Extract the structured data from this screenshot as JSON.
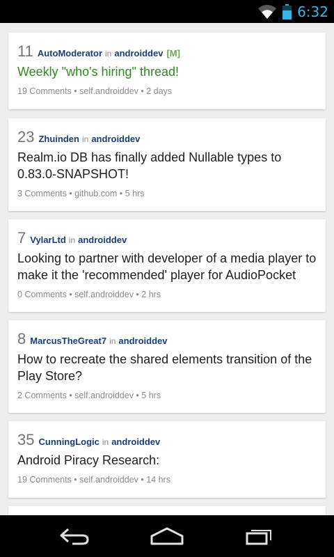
{
  "status_bar": {
    "time": "6:32",
    "wifi_icon": "wifi-icon",
    "battery_icon": "battery-icon"
  },
  "posts": [
    {
      "score": "11",
      "author": "AutoModerator",
      "in_word": "in",
      "subreddit": "androiddev",
      "mod_tag": "[M]",
      "title": "Weekly \"who's hiring\" thread!",
      "footer": "19 Comments • self.androiddev • 2 days"
    },
    {
      "score": "23",
      "author": "Zhuinden",
      "in_word": "in",
      "subreddit": "androiddev",
      "title": "Realm.io DB has finally added Nullable types to 0.83.0-SNAPSHOT!",
      "footer": "3 Comments • github.com • 5 hrs"
    },
    {
      "score": "7",
      "author": "VylarLtd",
      "in_word": "in",
      "subreddit": "androiddev",
      "title": "Looking to partner with developer of a media player to make it the 'recommended' player for AudioPocket",
      "footer": "0 Comments • self.androiddev • 2 hrs"
    },
    {
      "score": "8",
      "author": "MarcusTheGreat7",
      "in_word": "in",
      "subreddit": "androiddev",
      "title": "How to recreate the shared elements transition of the Play Store?",
      "footer": "2 Comments • self.androiddev • 5 hrs"
    },
    {
      "score": "35",
      "author": "CunningLogic",
      "in_word": "in",
      "subreddit": "androiddev",
      "title": "Android Piracy Research:",
      "footer": "19 Comments • self.androiddev • 14 hrs"
    }
  ],
  "nav_bar": {
    "back_icon": "back-icon",
    "home_icon": "home-icon",
    "recents_icon": "recents-icon"
  },
  "colors": {
    "background": "#eeeeee",
    "author": "#1a3d7a",
    "stickied_title": "#2e8b1e",
    "mod_tag": "#6aa84f",
    "clock": "#33b5e5"
  }
}
